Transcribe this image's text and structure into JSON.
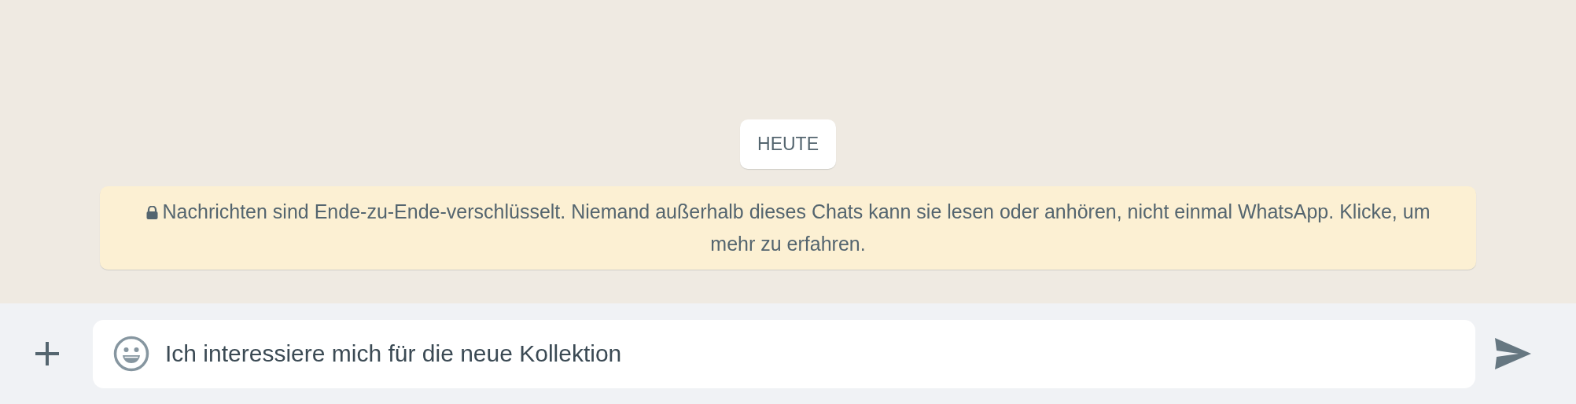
{
  "date_divider": "HEUTE",
  "encryption_notice": "Nachrichten sind Ende-zu-Ende-verschlüsselt. Niemand außerhalb dieses Chats kann sie lesen oder anhören, nicht einmal WhatsApp. Klicke, um mehr zu erfahren.",
  "composer": {
    "value": "Ich interessiere mich für die neue Kollektion"
  }
}
